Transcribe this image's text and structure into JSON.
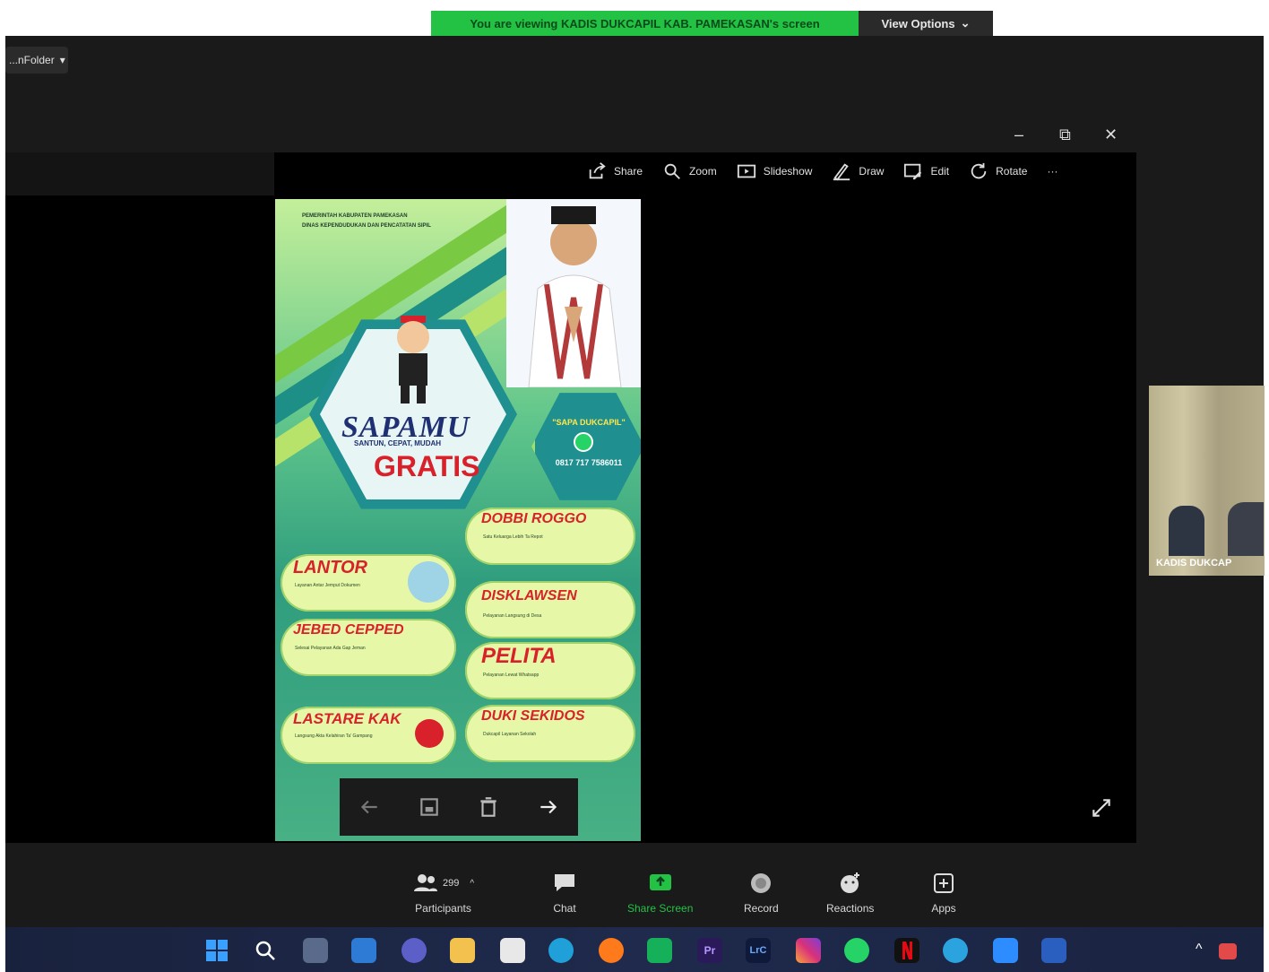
{
  "banner": {
    "text": "You are viewing KADIS DUKCAPIL KAB. PAMEKASAN's screen",
    "view_options": "View Options"
  },
  "tab_chip": {
    "label": "...nFolder"
  },
  "window_controls": {
    "minimize": "–",
    "restore": "⧉",
    "close": "✕"
  },
  "photo_toolbar": [
    {
      "label": "Share",
      "icon": "share-icon"
    },
    {
      "label": "Zoom",
      "icon": "zoom-icon"
    },
    {
      "label": "Slideshow",
      "icon": "slideshow-icon"
    },
    {
      "label": "Draw",
      "icon": "draw-icon"
    },
    {
      "label": "Edit",
      "icon": "edit-icon"
    },
    {
      "label": "Rotate",
      "icon": "rotate-icon"
    },
    {
      "label": "···",
      "icon": "more-icon"
    }
  ],
  "poster": {
    "header": [
      "PEMERINTAH KABUPATEN PAMEKASAN",
      "DINAS KEPENDUDUKAN DAN PENCATATAN SIPIL"
    ],
    "brand": "SAPAMU",
    "tagline": "SANTUN, CEPAT, MUDAH",
    "gratis": "GRATIS",
    "wa_title": "\"SAPA DUKCAPIL\"",
    "wa_number": "0817 717 7586011",
    "services": [
      {
        "title": "DOBBI ROGGO",
        "text": "Satu Keluarga Lebih Ta Repot"
      },
      {
        "title": "LANTOR",
        "text": "Layanan Antar Jemput Dokumen"
      },
      {
        "title": "DISKLAWSEN",
        "text": "Pelayanan Langsung di Desa"
      },
      {
        "title": "JEBED CEPPED",
        "text": "Selesai Pelayanan Ada Gap Jeman"
      },
      {
        "title": "PELITA",
        "text": "Pelayanan Lewat Whatsapp"
      },
      {
        "title": "LASTARE KAK",
        "text": "Langsung Akta Kelahiran Ta' Gampang"
      },
      {
        "title": "DUKI SEKIDOS",
        "text": "Dukcapil Layanan Sekolah"
      }
    ]
  },
  "participant_label": "KADIS DUKCAP",
  "meeting_controls": [
    {
      "label": "Participants",
      "count": "299",
      "icon": "participants-icon"
    },
    {
      "label": "Chat",
      "icon": "chat-icon"
    },
    {
      "label": "Share Screen",
      "icon": "share-screen-icon"
    },
    {
      "label": "Record",
      "icon": "record-icon"
    },
    {
      "label": "Reactions",
      "icon": "reactions-icon"
    },
    {
      "label": "Apps",
      "icon": "apps-icon"
    }
  ],
  "colors": {
    "banner_green": "#23c244",
    "share_green": "#23c244",
    "taskbar": "#1b2442",
    "pill_red": "#d8212a"
  }
}
